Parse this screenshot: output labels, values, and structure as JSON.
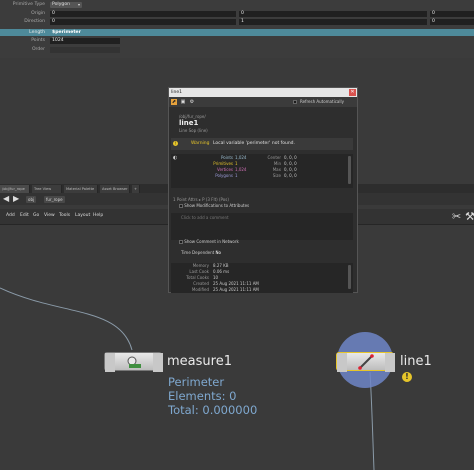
{
  "params": {
    "primitive_type": {
      "label": "Primitive Type",
      "value": "Polygon"
    },
    "origin": {
      "label": "Origin",
      "values": [
        "0",
        "0",
        "0"
      ]
    },
    "direction": {
      "label": "Direction",
      "values": [
        "0",
        "1",
        "0"
      ]
    },
    "length": {
      "label": "Length",
      "value": "$perimeter"
    },
    "points": {
      "label": "Points",
      "value": "1024"
    },
    "order": {
      "label": "Order"
    }
  },
  "tabs": [
    "/obj/fur_rope",
    "Tree View",
    "Material Palette",
    "Asset Browser",
    "+"
  ],
  "path": {
    "obj": "obj",
    "node": "fur_rope"
  },
  "menubar": [
    "Add",
    "Edit",
    "Go",
    "View",
    "Tools",
    "Layout",
    "Help"
  ],
  "info": {
    "window_title": "line1",
    "refresh_label": "Refresh Automatically",
    "node_path": "/obj/fur_rope/",
    "node_name": "line1",
    "node_type": "Line Sop (line)",
    "warning_label": "Warning",
    "warning_text": "Local variable 'perimeter' not found.",
    "stats_left": [
      {
        "key": "Points",
        "value": "1,024"
      },
      {
        "key": "Primitives",
        "value": "1"
      },
      {
        "key": "Vertices",
        "value": "1,024"
      },
      {
        "key": "Polygons",
        "value": "1"
      }
    ],
    "stats_right": [
      {
        "key": "Center",
        "value": "0, 0, 0"
      },
      {
        "key": "Min",
        "value": "0, 0, 0"
      },
      {
        "key": "Max",
        "value": "0, 0, 0"
      },
      {
        "key": "Size",
        "value": "0, 0, 0"
      }
    ],
    "point_attrs": "1 Point Attrs  ▸  P  (3 Flt)  (Pos)",
    "show_modifications": "Show Modifications to Attributes",
    "comment_placeholder": "Click to add a comment",
    "show_comment": "Show Comment in Network",
    "time_dependent_label": "Time Dependent",
    "time_dependent_value": "No",
    "meta": [
      {
        "key": "Memory",
        "value": "8.27 KB"
      },
      {
        "key": "Last Cook",
        "value": "0.06 ms"
      },
      {
        "key": "Total Cooks",
        "value": "10"
      },
      {
        "key": "Created",
        "value": "25 Aug 2021 11:11 AM"
      },
      {
        "key": "Modified",
        "value": "25 Aug 2021 11:11 AM"
      }
    ]
  },
  "nodes": {
    "measure": {
      "name": "measure1",
      "info_lines": [
        "Perimeter",
        "Elements: 0",
        "Total: 0.000000"
      ]
    },
    "line": {
      "name": "line1",
      "warning_badge": "!"
    }
  },
  "colors": {
    "accent_teal": "#4e8a9a",
    "warning_yellow": "#e6c52a",
    "info_blue": "#7fa8cf",
    "selection_ring": "#6e86c8"
  },
  "icons": [
    "pin-icon",
    "refresh-icon",
    "gear-icon",
    "warning-icon",
    "back-arrow-icon",
    "forward-arrow-icon",
    "wrench-icon",
    "tools-icon",
    "close-icon"
  ]
}
